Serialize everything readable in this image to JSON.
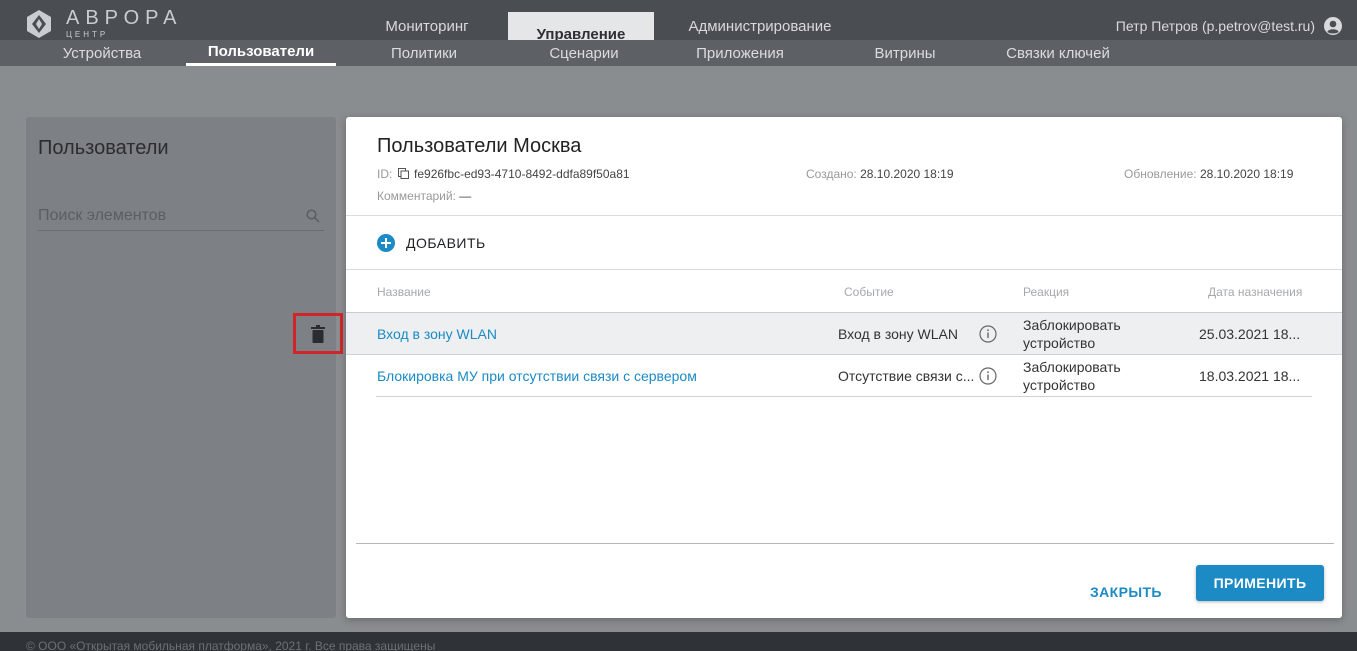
{
  "app": {
    "logo_title": "АВРОРА",
    "logo_subtitle": "ЦЕНТР",
    "main_tabs": [
      {
        "label": "Мониторинг"
      },
      {
        "label": "Управление"
      },
      {
        "label": "Администрирование"
      }
    ],
    "user": "Петр Петров (p.petrov@test.ru)",
    "sub_tabs": [
      {
        "label": "Устройства"
      },
      {
        "label": "Пользователи"
      },
      {
        "label": "Политики"
      },
      {
        "label": "Сценарии"
      },
      {
        "label": "Приложения"
      },
      {
        "label": "Витрины"
      },
      {
        "label": "Связки ключей"
      }
    ],
    "active_main_tab": "Управление",
    "active_sub_tab": "Пользователи"
  },
  "left_panel": {
    "title": "Пользователи",
    "search_placeholder": "Поиск элементов"
  },
  "dialog": {
    "title": "Пользователи Москва",
    "id_label": "ID:",
    "id_value": "fe926fbc-ed93-4710-8492-ddfa89f50a81",
    "comment_label": "Комментарий:",
    "comment_value": "—",
    "created_label": "Создано:",
    "created_value": "28.10.2020 18:19",
    "updated_label": "Обновление:",
    "updated_value": "28.10.2020 18:19",
    "add_label": "ДОБАВИТЬ",
    "columns": [
      "Название",
      "Событие",
      "Реакция",
      "Дата назначения"
    ],
    "rows": [
      {
        "name": "Вход в зону WLAN",
        "event": "Вход в зону WLAN",
        "reaction_line1": "Заблокировать",
        "reaction_line2": "устройство",
        "date": "25.03.2021 18..."
      },
      {
        "name": "Блокировка МУ при отсутствии связи с сервером",
        "event": "Отсутствие связи с...",
        "reaction_line1": "Заблокировать",
        "reaction_line2": "устройство",
        "date": "18.03.2021 18..."
      }
    ],
    "close_label": "ЗАКРЫТЬ",
    "apply_label": "ПРИМЕНИТЬ"
  },
  "footer": {
    "text": "© ООО «Открытая мобильная платформа», 2021 г. Все права защищены"
  },
  "colors": {
    "accent": "#1b8ac5",
    "highlight_frame": "#d0262b",
    "header_bg": "#4a4d52"
  }
}
